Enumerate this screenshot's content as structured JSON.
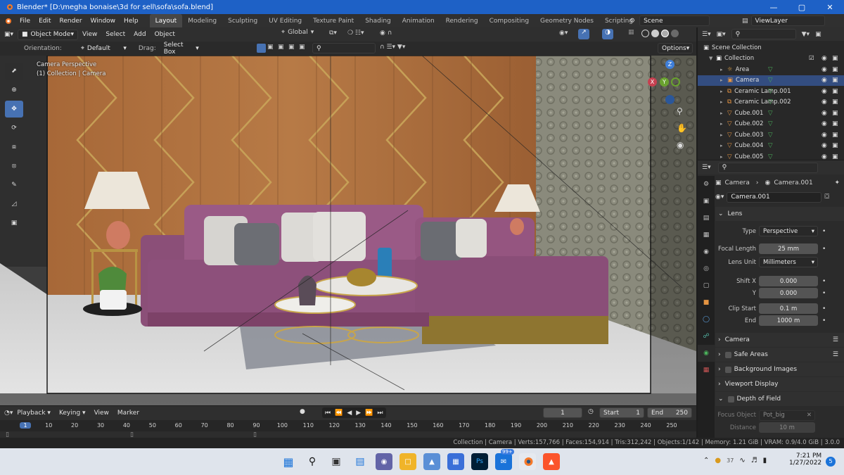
{
  "titlebar": {
    "title": "Blender* [D:\\megha bonaise\\3d for sell\\sofa\\sofa.blend]"
  },
  "menubar": {
    "menus": [
      "File",
      "Edit",
      "Render",
      "Window",
      "Help"
    ],
    "workspaces": [
      "Layout",
      "Modeling",
      "Sculpting",
      "UV Editing",
      "Texture Paint",
      "Shading",
      "Animation",
      "Rendering",
      "Compositing",
      "Geometry Nodes",
      "Scripting"
    ],
    "add_tab": "+",
    "scene": "Scene",
    "view_layer": "ViewLayer"
  },
  "viewport_header": {
    "mode": "Object Mode",
    "menus": [
      "View",
      "Select",
      "Add",
      "Object"
    ],
    "transform_orientation": "Global",
    "orientation_label": "Orientation:",
    "orientation_value": "Default",
    "drag_label": "Drag:",
    "drag_value": "Select Box",
    "options": "Options"
  },
  "viewport": {
    "overlay_line1": "Camera Perspective",
    "overlay_line2": "(1) Collection | Camera",
    "gizmo": {
      "z": "Z",
      "y": "Y",
      "x": "X"
    }
  },
  "outliner": {
    "root": "Scene Collection",
    "collection": "Collection",
    "items": [
      {
        "name": "Area",
        "type": "light"
      },
      {
        "name": "Camera",
        "type": "camera",
        "selected": true
      },
      {
        "name": "Ceramic Lamp.001",
        "type": "armature"
      },
      {
        "name": "Ceramic Lamp.002",
        "type": "armature"
      },
      {
        "name": "Cube.001",
        "type": "mesh"
      },
      {
        "name": "Cube.002",
        "type": "mesh"
      },
      {
        "name": "Cube.003",
        "type": "mesh"
      },
      {
        "name": "Cube.004",
        "type": "mesh"
      },
      {
        "name": "Cube.005",
        "type": "mesh"
      }
    ]
  },
  "properties": {
    "breadcrumb_object": "Camera",
    "breadcrumb_data": "Camera.001",
    "datablock": "Camera.001",
    "lens_section": "Lens",
    "type_label": "Type",
    "type_value": "Perspective",
    "focal_label": "Focal Length",
    "focal_value": "25 mm",
    "lens_unit_label": "Lens Unit",
    "lens_unit_value": "Millimeters",
    "shift_x_label": "Shift X",
    "shift_x_value": "0.000",
    "shift_y_label": "Y",
    "shift_y_value": "0.000",
    "clip_start_label": "Clip Start",
    "clip_start_value": "0.1 m",
    "clip_end_label": "End",
    "clip_end_value": "1000 m",
    "sections": [
      "Camera",
      "Safe Areas",
      "Background Images",
      "Viewport Display",
      "Depth of Field"
    ],
    "focus_object_label": "Focus Object",
    "focus_object_value": "Pot_big",
    "distance_label": "Distance",
    "distance_value": "10 m"
  },
  "timeline": {
    "menus": [
      "Playback",
      "Keying",
      "View",
      "Marker"
    ],
    "current_frame": "1",
    "start_label": "Start",
    "start_value": "1",
    "end_label": "End",
    "end_value": "250",
    "ticks": [
      "1",
      "10",
      "20",
      "30",
      "40",
      "50",
      "60",
      "70",
      "80",
      "90",
      "100",
      "110",
      "120",
      "130",
      "140",
      "150",
      "160",
      "170",
      "180",
      "190",
      "200",
      "210",
      "220",
      "230",
      "240",
      "250"
    ]
  },
  "statusbar": {
    "text": "Collection | Camera | Verts:157,766 | Faces:154,914 | Tris:312,242 | Objects:1/142 | Memory: 1.21 GiB | VRAM: 0.9/4.0 GiB | 3.0.0"
  },
  "taskbar": {
    "badge": "99+",
    "temperature": "37",
    "time": "7:21 PM",
    "date": "1/27/2022",
    "notif": "5"
  },
  "colors": {
    "accent": "#4772b3",
    "titlebar": "#1e61c6",
    "selected_row": "#334d80"
  }
}
